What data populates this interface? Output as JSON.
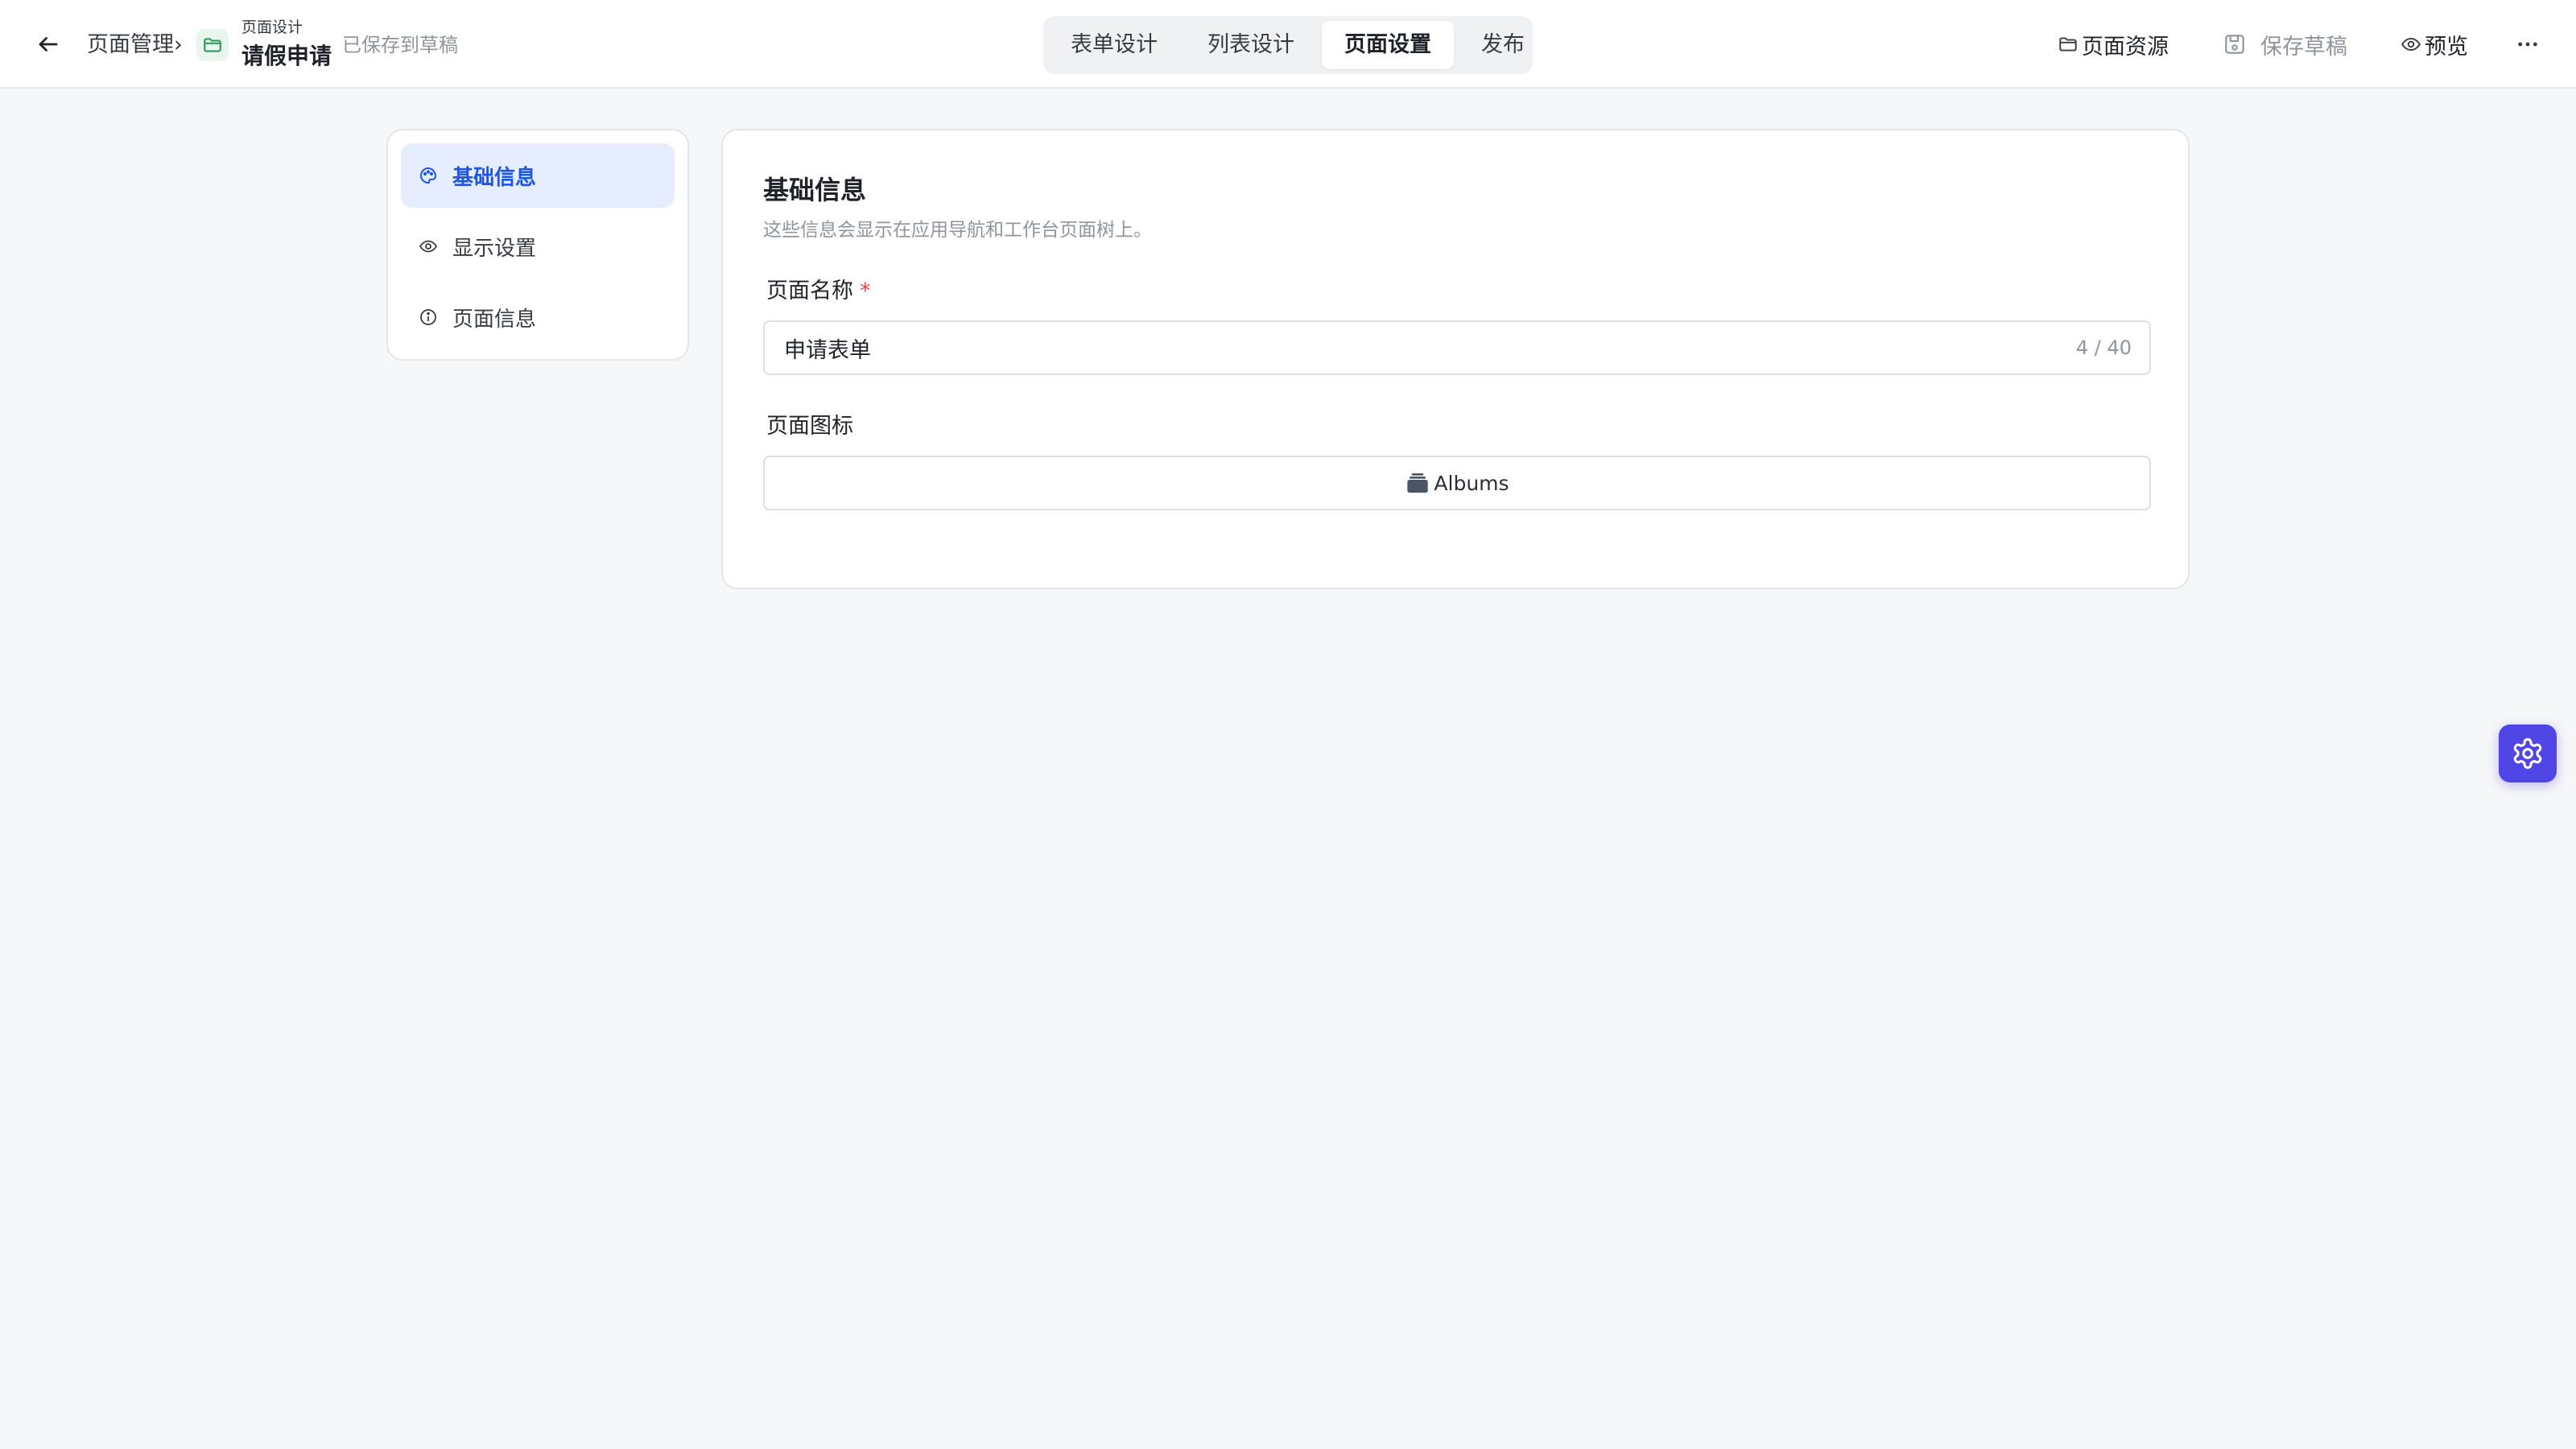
{
  "header": {
    "breadcrumb_parent": "页面管理",
    "breadcrumb_separator": "›",
    "page_subtitle": "页面设计",
    "page_title": "请假申请",
    "save_status": "已保存到草稿",
    "tabs": [
      {
        "label": "表单设计",
        "active": false
      },
      {
        "label": "列表设计",
        "active": false
      },
      {
        "label": "页面设置",
        "active": true
      },
      {
        "label": "发布",
        "active": false
      }
    ],
    "actions": {
      "resources": "页面资源",
      "save_draft": "保存草稿",
      "preview": "预览"
    }
  },
  "settings_nav": {
    "items": [
      {
        "label": "基础信息",
        "icon": "palette-icon",
        "active": true
      },
      {
        "label": "显示设置",
        "icon": "eye-icon",
        "active": false
      },
      {
        "label": "页面信息",
        "icon": "info-icon",
        "active": false
      }
    ]
  },
  "basic_info": {
    "title": "基础信息",
    "description": "这些信息会显示在应用导航和工作台页面树上。",
    "name_field": {
      "label": "页面名称",
      "required_mark": "*",
      "value": "申请表单",
      "counter": "4 / 40"
    },
    "icon_field": {
      "label": "页面图标",
      "icon": "albums-icon",
      "value": "Albums"
    }
  },
  "colors": {
    "accent": "#1e56e0",
    "active_nav_bg": "#e5edff",
    "fab": "#4f46e5",
    "required": "#e5484d"
  }
}
